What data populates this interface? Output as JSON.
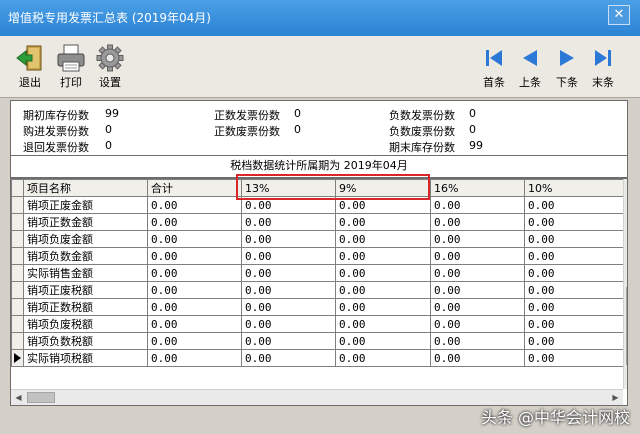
{
  "window": {
    "title": "增值税专用发票汇总表 (2019年04月)",
    "close_glyph": "✕"
  },
  "toolbar": {
    "left_buttons": [
      {
        "label": "退出",
        "icon": "exit-door-icon"
      },
      {
        "label": "打印",
        "icon": "printer-icon"
      },
      {
        "label": "设置",
        "icon": "gear-icon"
      }
    ],
    "nav_buttons": [
      {
        "label": "首条",
        "icon": "first-record-icon"
      },
      {
        "label": "上条",
        "icon": "previous-record-icon"
      },
      {
        "label": "下条",
        "icon": "next-record-icon"
      },
      {
        "label": "末条",
        "icon": "last-record-icon"
      }
    ]
  },
  "summary": {
    "col1": [
      {
        "label": "期初库存份数",
        "value": "99"
      },
      {
        "label": "购进发票份数",
        "value": "0"
      },
      {
        "label": "退回发票份数",
        "value": "0"
      }
    ],
    "col2": [
      {
        "label": "正数发票份数",
        "value": "0"
      },
      {
        "label": "正数废票份数",
        "value": "0"
      }
    ],
    "col3": [
      {
        "label": "负数发票份数",
        "value": "0"
      },
      {
        "label": "负数废票份数",
        "value": "0"
      },
      {
        "label": "期末库存份数",
        "value": "99"
      }
    ]
  },
  "period_label": "税档数据统计所属期为 2019年04月",
  "grid": {
    "headers": [
      "项目名称",
      "合计",
      "13%",
      "9%",
      "16%",
      "10%"
    ],
    "rows": [
      {
        "name": "销项正废金额",
        "values": [
          "0.00",
          "0.00",
          "0.00",
          "0.00",
          "0.00"
        ]
      },
      {
        "name": "销项正数金额",
        "values": [
          "0.00",
          "0.00",
          "0.00",
          "0.00",
          "0.00"
        ]
      },
      {
        "name": "销项负废金额",
        "values": [
          "0.00",
          "0.00",
          "0.00",
          "0.00",
          "0.00"
        ]
      },
      {
        "name": "销项负数金额",
        "values": [
          "0.00",
          "0.00",
          "0.00",
          "0.00",
          "0.00"
        ]
      },
      {
        "name": "实际销售金额",
        "values": [
          "0.00",
          "0.00",
          "0.00",
          "0.00",
          "0.00"
        ]
      },
      {
        "name": "销项正废税额",
        "values": [
          "0.00",
          "0.00",
          "0.00",
          "0.00",
          "0.00"
        ]
      },
      {
        "name": "销项正数税额",
        "values": [
          "0.00",
          "0.00",
          "0.00",
          "0.00",
          "0.00"
        ]
      },
      {
        "name": "销项负废税额",
        "values": [
          "0.00",
          "0.00",
          "0.00",
          "0.00",
          "0.00"
        ]
      },
      {
        "name": "销项负数税额",
        "values": [
          "0.00",
          "0.00",
          "0.00",
          "0.00",
          "0.00"
        ]
      },
      {
        "name": "实际销项税额",
        "values": [
          "0.00",
          "0.00",
          "0.00",
          "0.00",
          "0.00"
        ]
      }
    ],
    "current_row_index": 9
  },
  "annotation_color": "#d9262b",
  "watermark": "头条 @中华会计网校"
}
